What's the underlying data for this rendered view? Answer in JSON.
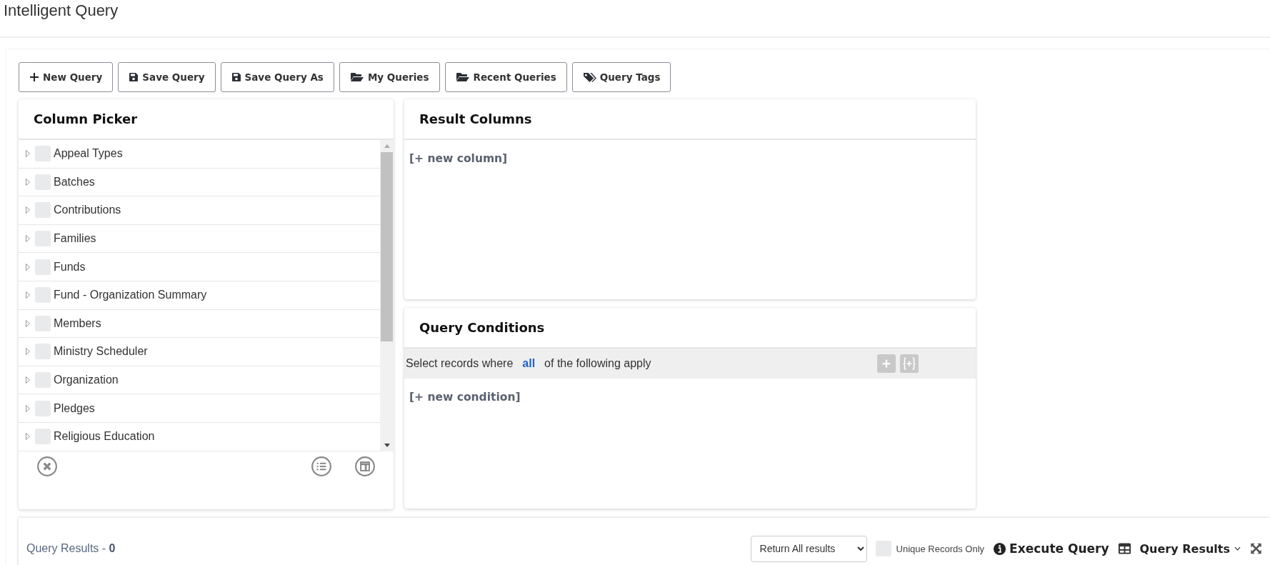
{
  "page": {
    "title": "Intelligent Query"
  },
  "toolbar": [
    {
      "label": "New Query",
      "kind": "create"
    },
    {
      "label": "Save Query",
      "kind": "save"
    },
    {
      "label": "Save Query As",
      "kind": "save"
    },
    {
      "label": "My Queries",
      "kind": "open"
    },
    {
      "label": "Recent Queries",
      "kind": "open"
    },
    {
      "label": "Query Tags",
      "kind": "tag"
    }
  ],
  "column_picker": {
    "title": "Column Picker",
    "items": [
      {
        "label": "Appeal Types",
        "checked": false,
        "expanded": false
      },
      {
        "label": "Batches",
        "checked": false,
        "expanded": false
      },
      {
        "label": "Contributions",
        "checked": false,
        "expanded": false
      },
      {
        "label": "Families",
        "checked": false,
        "expanded": false
      },
      {
        "label": "Funds",
        "checked": false,
        "expanded": false
      },
      {
        "label": "Fund - Organization Summary",
        "checked": false,
        "expanded": false
      },
      {
        "label": "Members",
        "checked": false,
        "expanded": false
      },
      {
        "label": "Ministry Scheduler",
        "checked": false,
        "expanded": false
      },
      {
        "label": "Organization",
        "checked": false,
        "expanded": false
      },
      {
        "label": "Pledges",
        "checked": false,
        "expanded": false
      },
      {
        "label": "Religious Education",
        "checked": false,
        "expanded": false
      }
    ]
  },
  "result_columns": {
    "title": "Result Columns",
    "add_link": "[+ new column]"
  },
  "query_conditions": {
    "title": "Query Conditions",
    "prefix": "Select records where",
    "operator": "all",
    "suffix": "of the following apply",
    "add_link": "[+ new condition]"
  },
  "query_results": {
    "label": "Query Results - ",
    "count": "0",
    "return_select": "Return All results",
    "unique_label": "Unique Records Only",
    "unique_checked": false,
    "execute": "Execute Query",
    "view_menu": "Query Results"
  }
}
